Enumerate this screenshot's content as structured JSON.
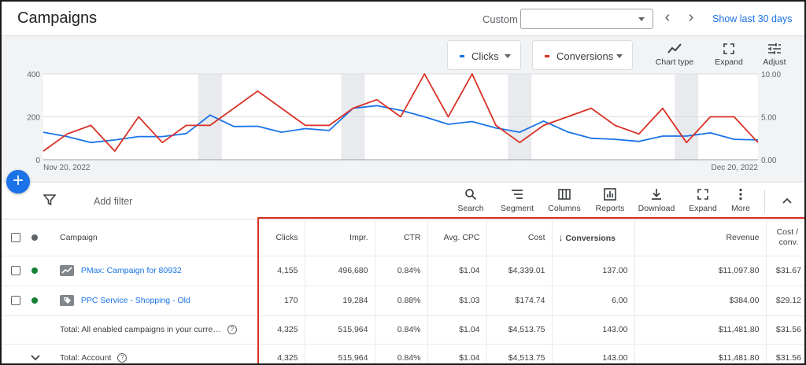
{
  "header": {
    "title": "Campaigns",
    "custom_label": "Custom",
    "date_value": "",
    "show_last": "Show last 30 days"
  },
  "chart_controls": {
    "metric1": "Clicks",
    "metric2": "Conversions",
    "chart_type": "Chart type",
    "expand": "Expand",
    "adjust": "Adjust"
  },
  "colors": {
    "clicks": "#1a73e8",
    "conversions": "#d93025",
    "accent": "#1a73e8"
  },
  "chart_data": {
    "type": "line",
    "x_start_label": "Nov 20, 2022",
    "x_end_label": "Dec 20, 2022",
    "left_ticks": [
      "0",
      "200",
      "400"
    ],
    "right_ticks": [
      "0.00",
      "5.00",
      "10.00"
    ],
    "ylim_left": [
      0,
      400
    ],
    "ylim_right": [
      0,
      10
    ],
    "series": [
      {
        "name": "Clicks",
        "axis": "left",
        "values": [
          128,
          108,
          80,
          92,
          108,
          108,
          122,
          208,
          155,
          156,
          128,
          145,
          136,
          240,
          252,
          230,
          200,
          165,
          178,
          148,
          128,
          180,
          130,
          100,
          95,
          85,
          110,
          110,
          125,
          95,
          92
        ]
      },
      {
        "name": "Conversions",
        "axis": "right",
        "values": [
          1,
          3,
          4,
          1,
          5,
          2,
          4,
          4,
          6,
          8,
          6,
          4,
          4,
          6,
          7,
          5,
          10,
          5,
          10,
          4,
          2,
          4,
          5,
          6,
          4,
          3,
          6,
          2,
          5,
          5,
          2
        ]
      }
    ]
  },
  "add_button": "+",
  "toolbar": {
    "add_filter": "Add filter",
    "tools": [
      "Search",
      "Segment",
      "Columns",
      "Reports",
      "Download",
      "Expand",
      "More"
    ]
  },
  "table": {
    "headers": {
      "campaign": "Campaign",
      "clicks": "Clicks",
      "impr": "Impr.",
      "ctr": "CTR",
      "avg_cpc": "Avg. CPC",
      "cost": "Cost",
      "conversions": "Conversions",
      "revenue": "Revenue",
      "cost_conv": "Cost / conv."
    },
    "rows": [
      {
        "name": "PMax: Campaign for 80932",
        "clicks": "4,155",
        "impr": "496,680",
        "ctr": "0.84%",
        "avg_cpc": "$1.04",
        "cost": "$4,339.01",
        "conversions": "137.00",
        "revenue": "$11,097.80",
        "cost_conv": "$31.67"
      },
      {
        "name": "PPC Service - Shopping - Old",
        "clicks": "170",
        "impr": "19,284",
        "ctr": "0.88%",
        "avg_cpc": "$1.03",
        "cost": "$174.74",
        "conversions": "6.00",
        "revenue": "$384.00",
        "cost_conv": "$29.12"
      }
    ],
    "total_enabled": {
      "label": "Total: All enabled campaigns in your curre…",
      "clicks": "4,325",
      "impr": "515,964",
      "ctr": "0.84%",
      "avg_cpc": "$1.04",
      "cost": "$4,513.75",
      "conversions": "143.00",
      "revenue": "$11,481.80",
      "cost_conv": "$31.56"
    },
    "total_account": {
      "label": "Total: Account",
      "clicks": "4,325",
      "impr": "515,964",
      "ctr": "0.84%",
      "avg_cpc": "$1.04",
      "cost": "$4,513.75",
      "conversions": "143.00",
      "revenue": "$11,481.80",
      "cost_conv": "$31.56"
    }
  }
}
